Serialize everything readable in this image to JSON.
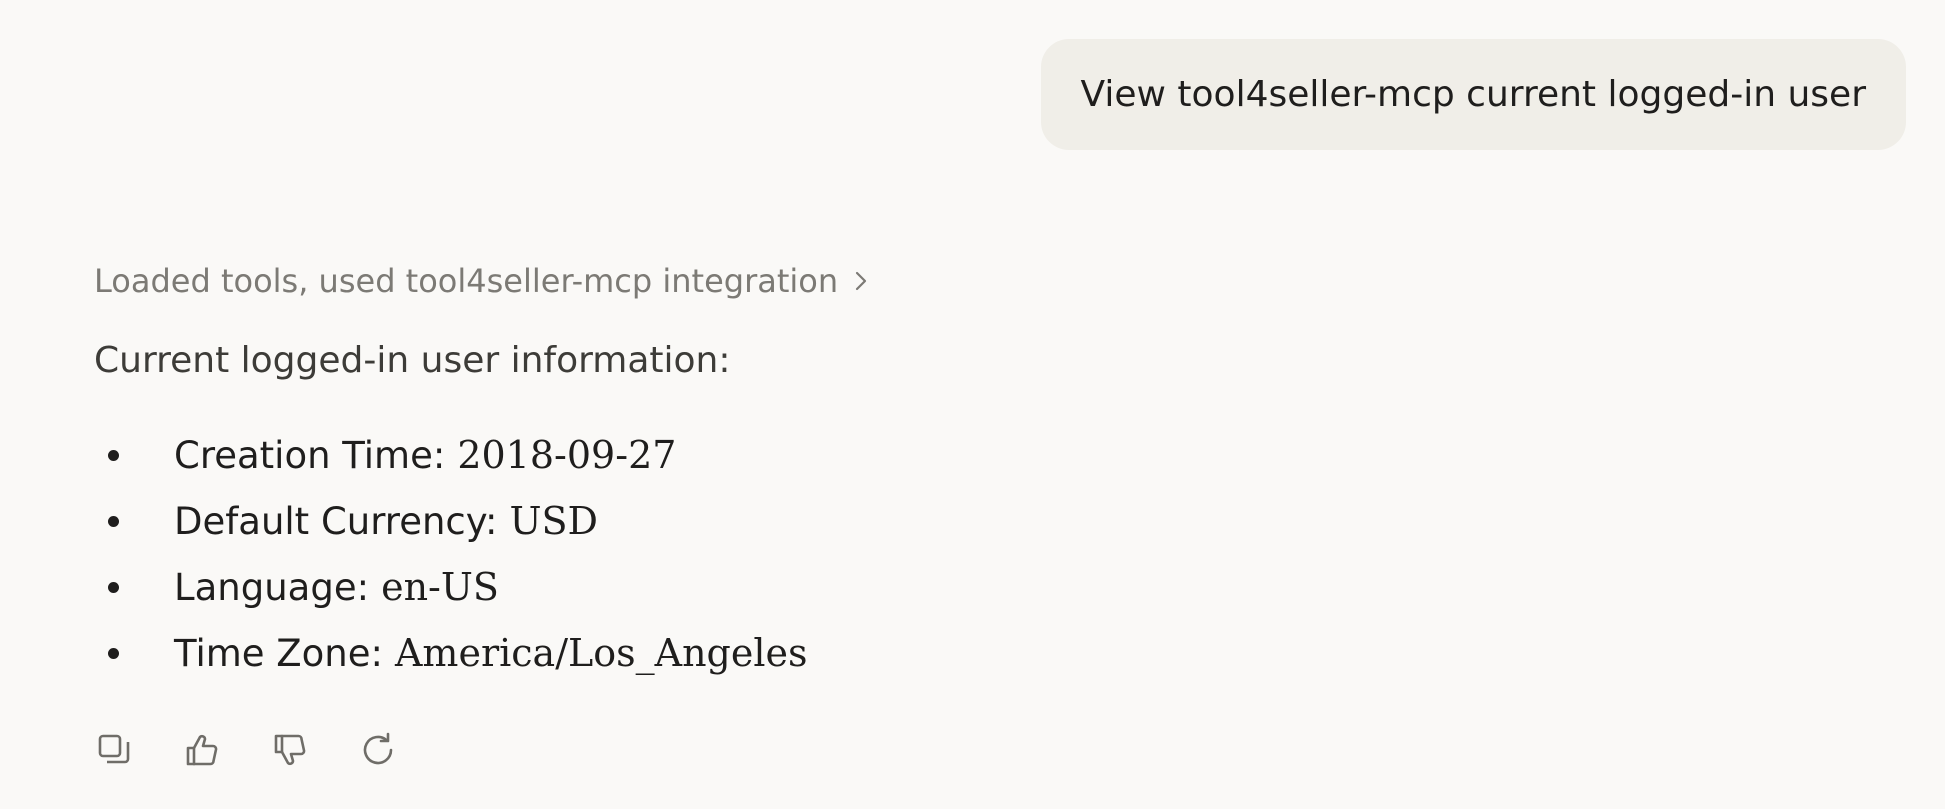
{
  "user_message": {
    "text": "View tool4seller-mcp current logged-in user"
  },
  "assistant": {
    "tool_summary": "Loaded tools, used tool4seller-mcp integration",
    "intro": "Current logged-in user information:",
    "items": [
      {
        "label": "Creation Time:",
        "value": "2018-09-27"
      },
      {
        "label": "Default Currency:",
        "value": "USD"
      },
      {
        "label": "Language:",
        "value": "en-US"
      },
      {
        "label": "Time Zone:",
        "value": "America/Los_Angeles"
      }
    ]
  },
  "actions": [
    {
      "icon": "copy-icon"
    },
    {
      "icon": "thumbs-up-icon"
    },
    {
      "icon": "thumbs-down-icon"
    },
    {
      "icon": "retry-icon"
    }
  ],
  "colors": {
    "background": "#faf9f7",
    "user_bubble": "#f0eee8",
    "muted_text": "#7c7a75",
    "text": "#1f1e1d"
  }
}
